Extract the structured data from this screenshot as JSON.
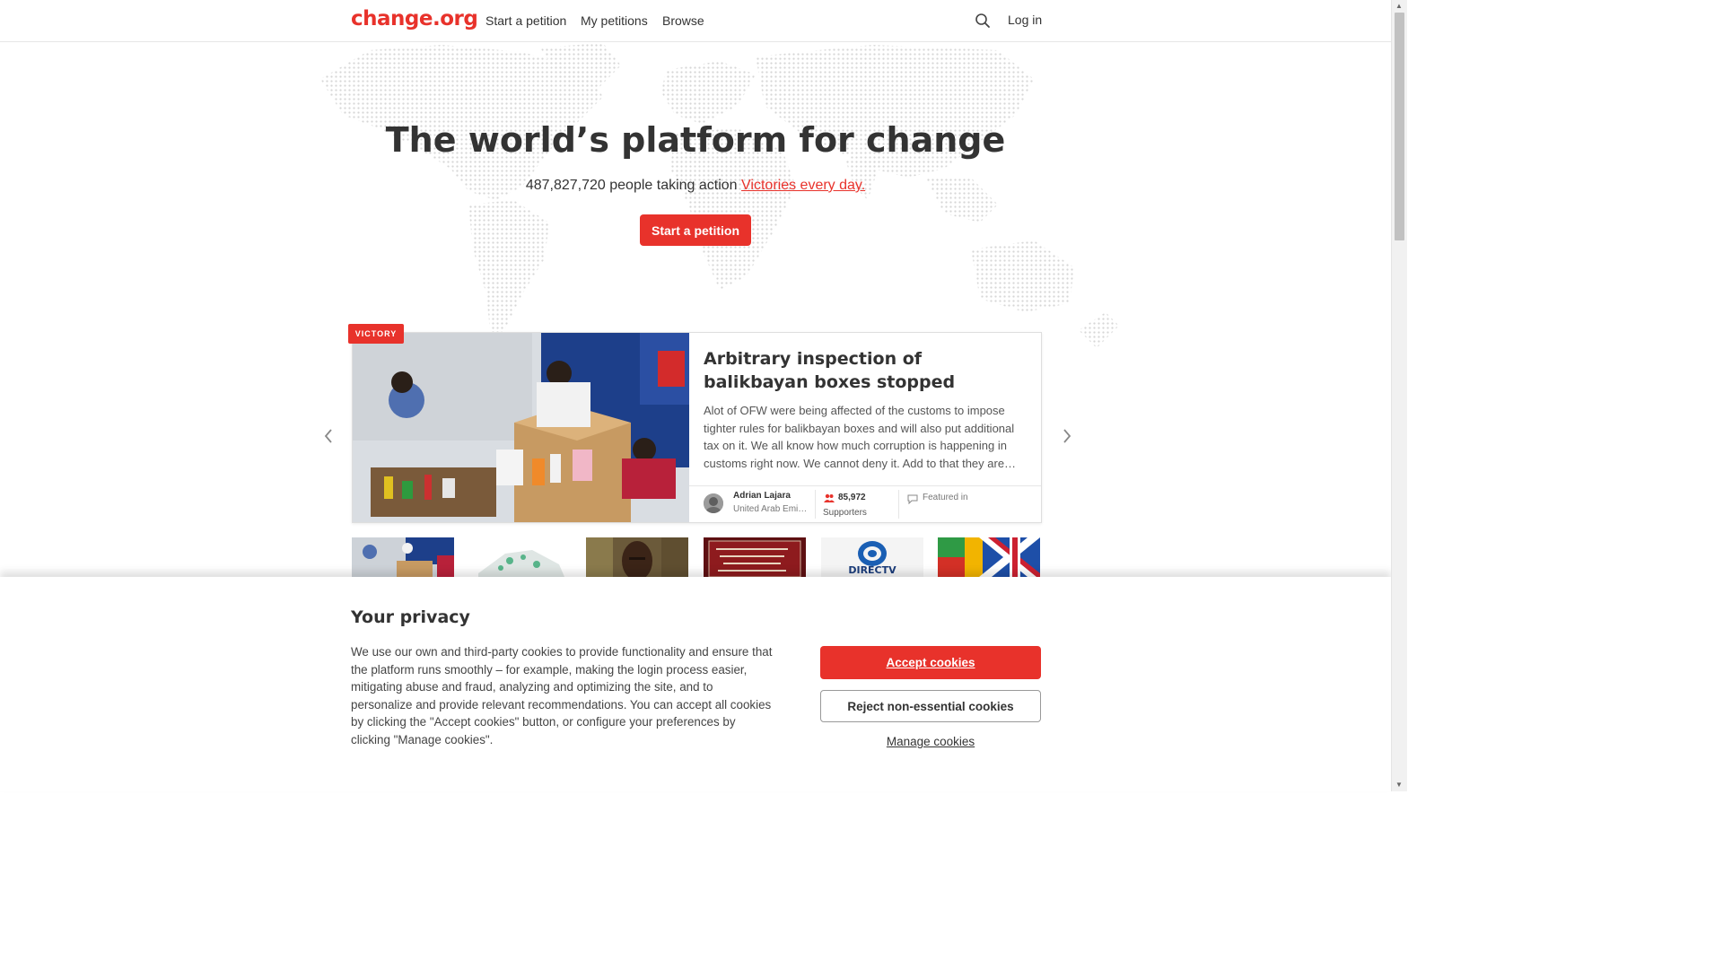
{
  "header": {
    "logo": "change.org",
    "nav": [
      "Start a petition",
      "My petitions",
      "Browse"
    ],
    "login": "Log in"
  },
  "hero": {
    "title": "The world’s platform for change",
    "people_count": "487,827,720 people taking action",
    "victories_link": "Victories every day.",
    "cta": "Start a petition"
  },
  "featured": {
    "badge": "VICTORY",
    "title": "Arbitrary inspection of balikbayan boxes stopped",
    "description": "Alot of OFW were being affected of the customs to impose tighter rules for balikbayan boxes and will also put additional tax on it. We all know how much corruption is happening in customs right now. We cannot deny it. Add to that they are…",
    "author_name": "Adrian Lajara",
    "author_location": "United Arab Emi…",
    "supporters_count": "85,972",
    "supporters_label": "Supporters",
    "featured_label": "Featured in"
  },
  "thumbnails": [
    {
      "name": "thumb-balikbayan",
      "text": ""
    },
    {
      "name": "thumb-map-pins",
      "text": ""
    },
    {
      "name": "thumb-portrait",
      "text": ""
    },
    {
      "name": "thumb-sign",
      "text": ""
    },
    {
      "name": "thumb-directv",
      "text": "DIRECTV"
    },
    {
      "name": "thumb-flags",
      "text": ""
    }
  ],
  "cookies": {
    "title": "Your privacy",
    "text": "We use our own and third-party cookies to provide functionality and ensure that the platform runs smoothly – for example, making the login process easier, mitigating abuse and fraud, analyzing and optimizing the site, and to personalize and provide relevant recommendations. You can accept all cookies by clicking the \"Accept cookies\" button, or configure your preferences by clicking \"Manage cookies\".",
    "accept": "Accept cookies",
    "reject": "Reject non-essential cookies",
    "manage": "Manage cookies"
  },
  "colors": {
    "brand": "#e8322b",
    "text": "#333333",
    "border": "#e6e6e6"
  },
  "icons": [
    "search-icon",
    "chevron-left-icon",
    "chevron-right-icon",
    "supporters-icon",
    "comment-icon"
  ]
}
